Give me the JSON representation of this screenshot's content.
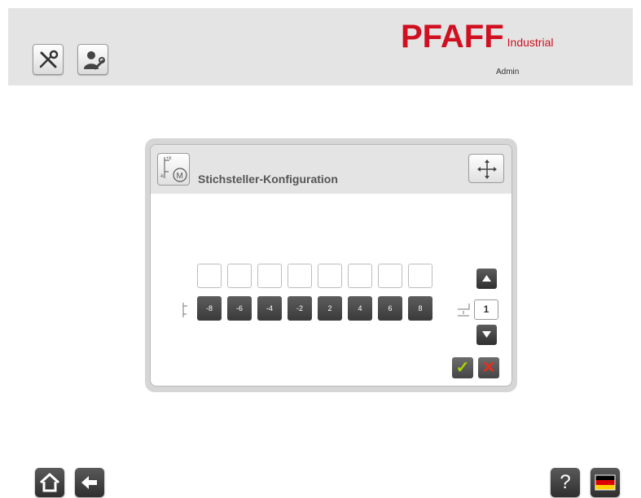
{
  "header": {
    "brand_name": "PFAFF",
    "brand_suffix": "Industrial",
    "user": "Admin",
    "buttons": [
      {
        "icon": "tools-icon"
      },
      {
        "icon": "user-settings-icon"
      }
    ]
  },
  "dialog": {
    "title": "Stichsteller-Konfiguration",
    "header_icon": "stitch-motor-icon",
    "move_icon": "move-icon",
    "step_values": [
      "-8",
      "-6",
      "-4",
      "-2",
      "2",
      "4",
      "6",
      "8"
    ],
    "slot_count": 8,
    "counter_value": "1",
    "up_icon": "arrow-up-icon",
    "down_icon": "arrow-down-icon",
    "confirm_icon": "checkmark-icon",
    "cancel_icon": "close-icon",
    "confirm_symbol": "✓",
    "cancel_symbol": "✕"
  },
  "footer": {
    "home_icon": "home-icon",
    "back_icon": "back-arrow-icon",
    "help_label": "?",
    "language_icon": "german-flag-icon"
  },
  "colors": {
    "brand": "#d01020",
    "header_bg": "#e4e4e4",
    "button_dark": "#3a3a3a",
    "confirm": "#a8d400",
    "cancel": "#e03020"
  }
}
